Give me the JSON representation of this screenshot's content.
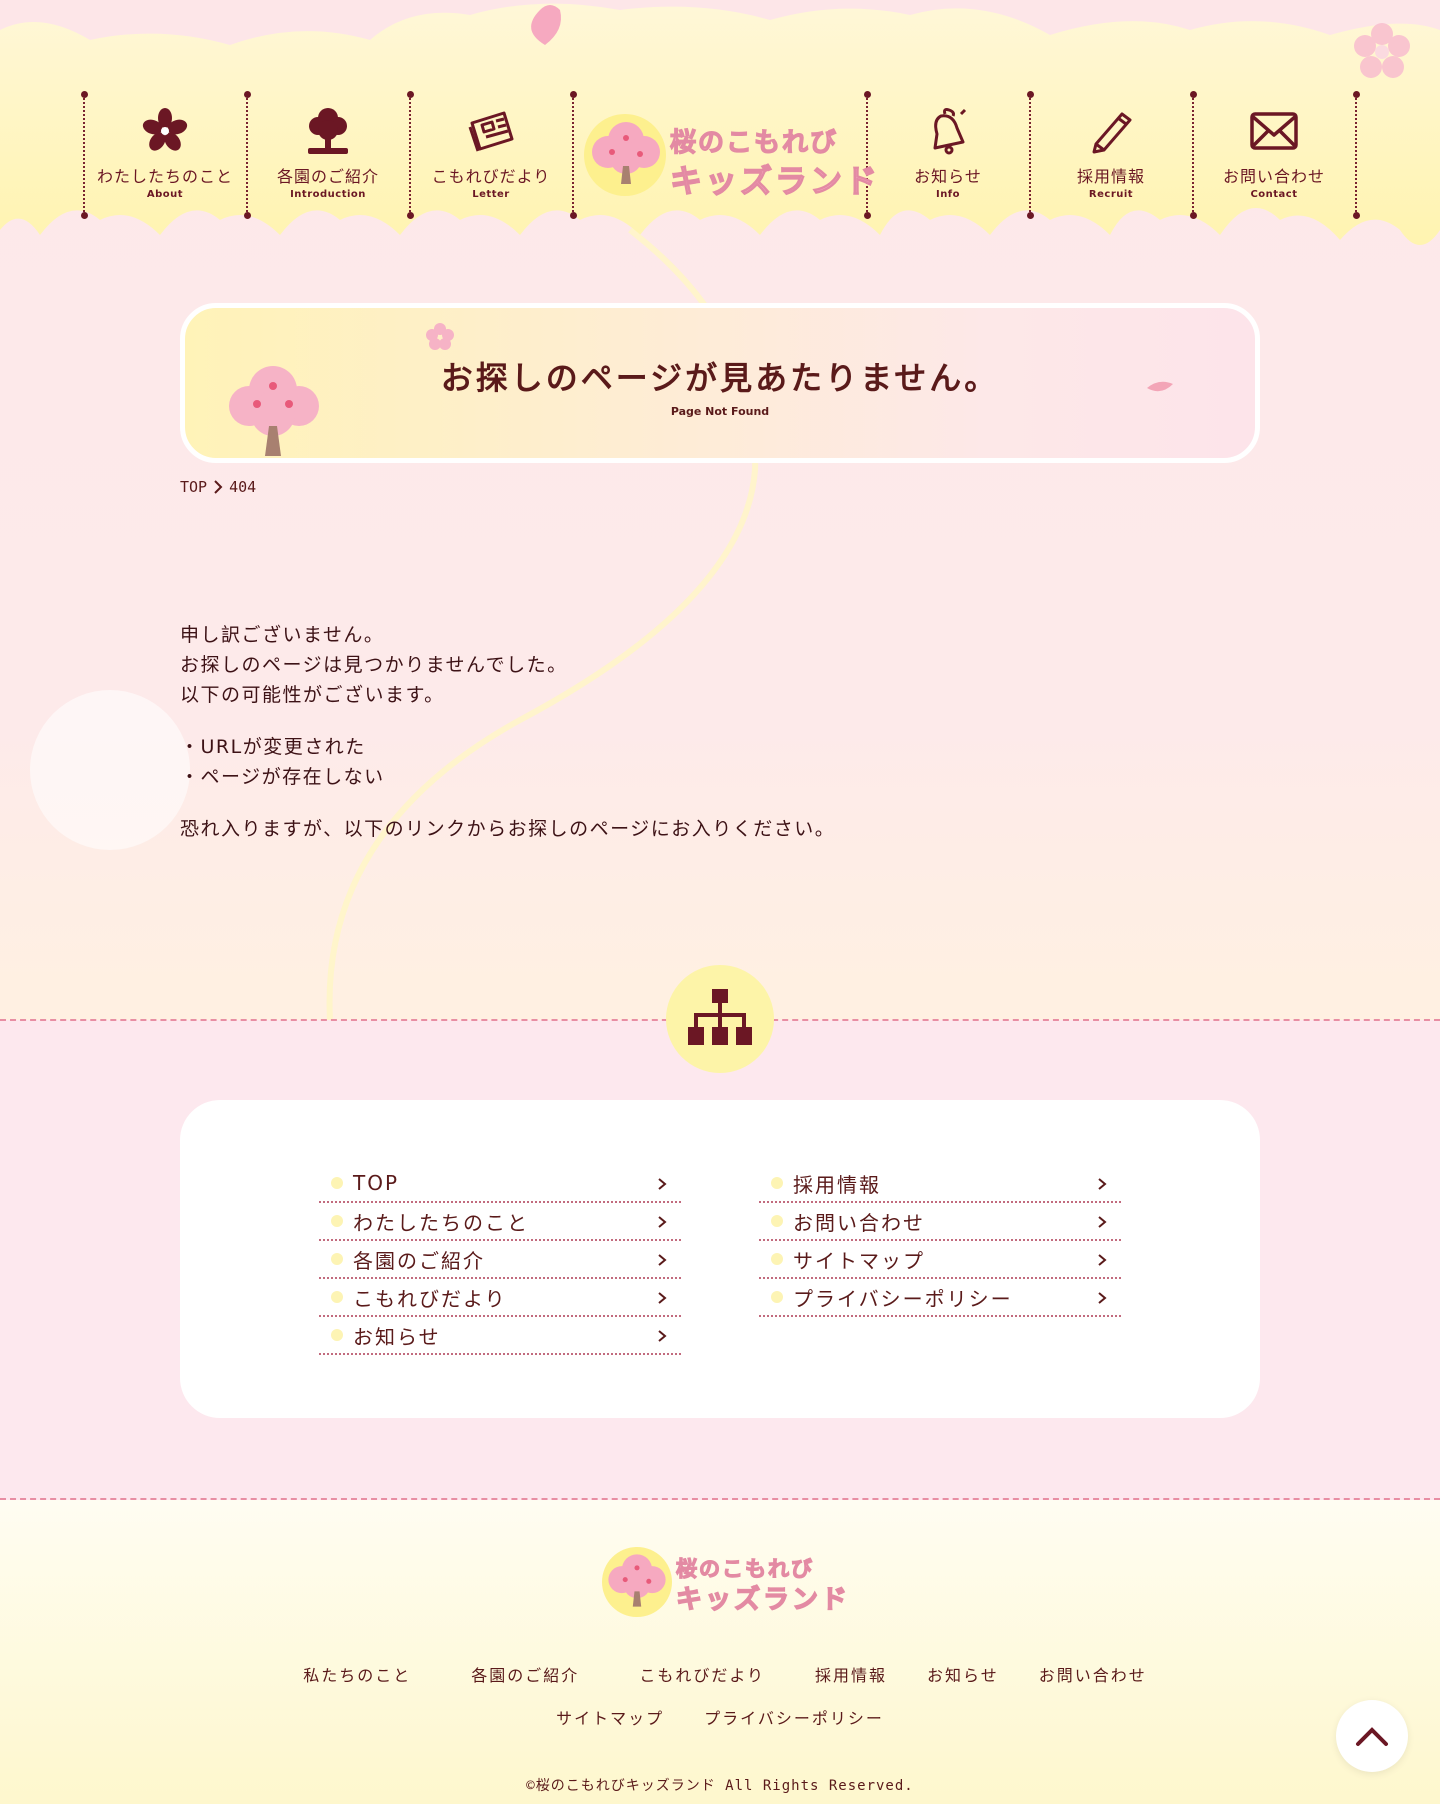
{
  "header": {
    "logo_line1": "桜のこもれび",
    "logo_line2": "キッズランド",
    "nav": [
      {
        "jp": "わたしたちのこと",
        "en": "About"
      },
      {
        "jp": "各園のご紹介",
        "en": "Introduction"
      },
      {
        "jp": "こもれびだより",
        "en": "Letter"
      },
      {
        "jp": "お知らせ",
        "en": "Info"
      },
      {
        "jp": "採用情報",
        "en": "Recruit"
      },
      {
        "jp": "お問い合わせ",
        "en": "Contact"
      }
    ]
  },
  "banner": {
    "title": "お探しのページが見あたりません。",
    "subtitle": "Page Not Found"
  },
  "breadcrumb": {
    "home": "TOP",
    "current": "404"
  },
  "message": {
    "line1": "申し訳ございません。",
    "line2": "お探しのページは見つかりませんでした。",
    "line3": "以下の可能性がございます。",
    "bullet1": "・URLが変更された",
    "bullet2": "・ページが存在しない",
    "closing": "恐れ入りますが、以下のリンクからお探しのページにお入りください。"
  },
  "sitemap": {
    "left": [
      "TOP",
      "わたしたちのこと",
      "各園のご紹介",
      "こもれびだより",
      "お知らせ"
    ],
    "right": [
      "採用情報",
      "お問い合わせ",
      "サイトマップ",
      "プライバシーポリシー"
    ]
  },
  "footer": {
    "logo_line1": "桜のこもれび",
    "logo_line2": "キッズランド",
    "nav_row1": [
      "私たちのこと",
      "各園のご紹介",
      "こもれびだより",
      "採用情報",
      "お知らせ",
      "お問い合わせ"
    ],
    "nav_row2": [
      "サイトマップ",
      "プライバシーポリシー"
    ],
    "copyright": "©桜のこもれびキッズランド All Rights Reserved."
  },
  "colors": {
    "text": "#5a1a1a",
    "accent_pink": "#f6a9c0",
    "accent_yellow": "#fdf08e",
    "dash": "#e88ea3"
  }
}
